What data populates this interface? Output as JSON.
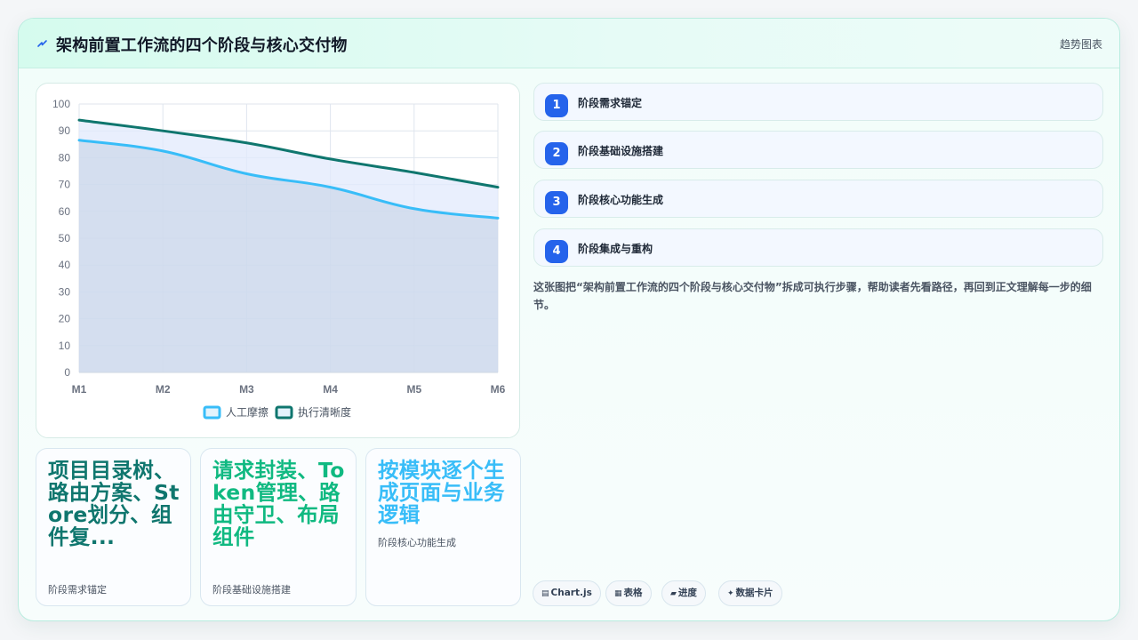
{
  "header": {
    "title": "架构前置工作流的四个阶段与核心交付物",
    "tag": "趋势图表"
  },
  "steps": [
    {
      "num": "1",
      "label": "阶段需求锚定"
    },
    {
      "num": "2",
      "label": "阶段基础设施搭建"
    },
    {
      "num": "3",
      "label": "阶段核心功能生成"
    },
    {
      "num": "4",
      "label": "阶段集成与重构"
    }
  ],
  "description": "这张图把“架构前置工作流的四个阶段与核心交付物”拆成可执行步骤，帮助读者先看路径，再回到正文理解每一步的细节。",
  "kpis": [
    {
      "value": "项目目录树、路由方案、Store划分、组件复...",
      "label": "阶段需求锚定",
      "color": "#0f766e"
    },
    {
      "value": "请求封装、Token管理、路由守卫、布局组件",
      "label": "阶段基础设施搭建",
      "color": "#10b981"
    },
    {
      "value": "按模块逐个生成页面与业务逻辑",
      "label": "阶段核心功能生成",
      "color": "#38bdf8"
    }
  ],
  "pills": [
    {
      "icon": "▤",
      "label": "Chart.js"
    },
    {
      "icon": "▦",
      "label": "表格"
    },
    {
      "icon": "▰",
      "label": "进度"
    },
    {
      "icon": "✦",
      "label": "数据卡片"
    }
  ],
  "chart_data": {
    "type": "area",
    "categories": [
      "M1",
      "M2",
      "M3",
      "M4",
      "M5",
      "M6"
    ],
    "ylim": [
      0,
      100
    ],
    "yticks": [
      0,
      10,
      20,
      30,
      40,
      50,
      60,
      70,
      80,
      90,
      100
    ],
    "grid": true,
    "legend_position": "bottom",
    "series": [
      {
        "name": "人工摩擦",
        "values": [
          86.5,
          82.5,
          74,
          69,
          61,
          57.5
        ],
        "color": "#38bdf8",
        "fill": "rgba(191, 205, 226, 0.5)"
      },
      {
        "name": "执行清晰度",
        "values": [
          94,
          90,
          85.5,
          79.5,
          74.5,
          69
        ],
        "color": "#0f766e",
        "fill": "rgba(226, 234, 252, 0.75)"
      }
    ]
  }
}
